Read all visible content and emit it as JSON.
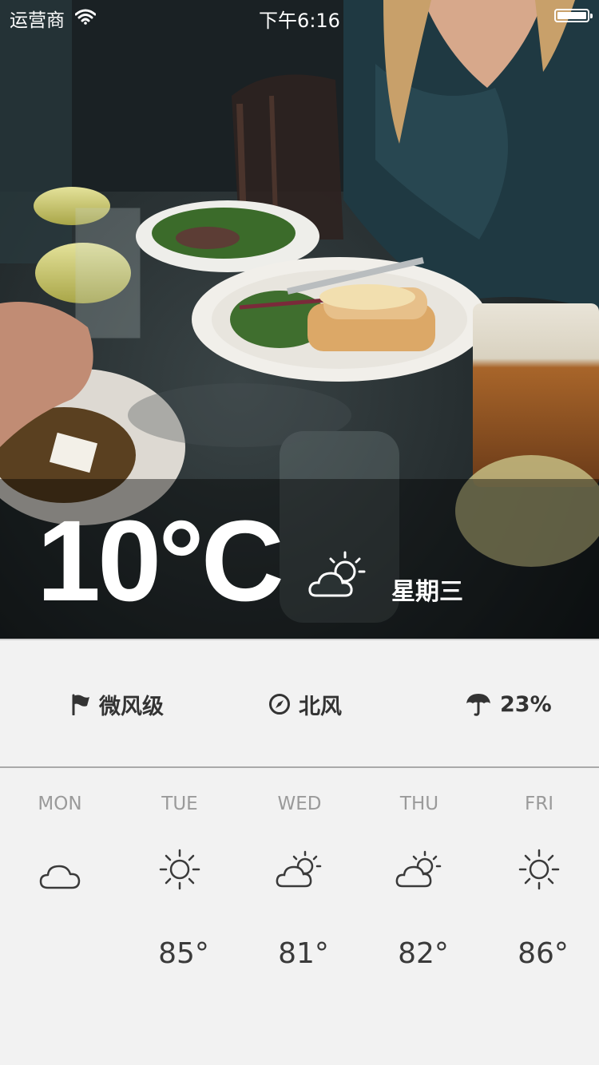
{
  "status_bar": {
    "carrier": "运营商",
    "time": "下午6:16",
    "battery_level": 1.0
  },
  "current": {
    "temperature": "10°C",
    "condition_icon": "partly-cloudy-icon",
    "weekday": "星期三"
  },
  "details": {
    "wind_level": {
      "icon": "flag-icon",
      "text": "微风级"
    },
    "wind_direction": {
      "icon": "compass-icon",
      "text": "北风"
    },
    "precipitation": {
      "icon": "umbrella-icon",
      "text": "23%"
    }
  },
  "forecast": [
    {
      "day": "MON",
      "icon": "cloud-icon",
      "temp": ""
    },
    {
      "day": "TUE",
      "icon": "sun-icon",
      "temp": "85°"
    },
    {
      "day": "WED",
      "icon": "partly-cloudy-icon",
      "temp": "81°"
    },
    {
      "day": "THU",
      "icon": "partly-cloudy-icon",
      "temp": "82°"
    },
    {
      "day": "FRI",
      "icon": "sun-icon",
      "temp": "86°"
    }
  ],
  "colors": {
    "panel_background": "#f2f2f2",
    "detail_text": "#333333",
    "forecast_day": "#9a9a9a",
    "forecast_temp": "#3a3a3a"
  }
}
